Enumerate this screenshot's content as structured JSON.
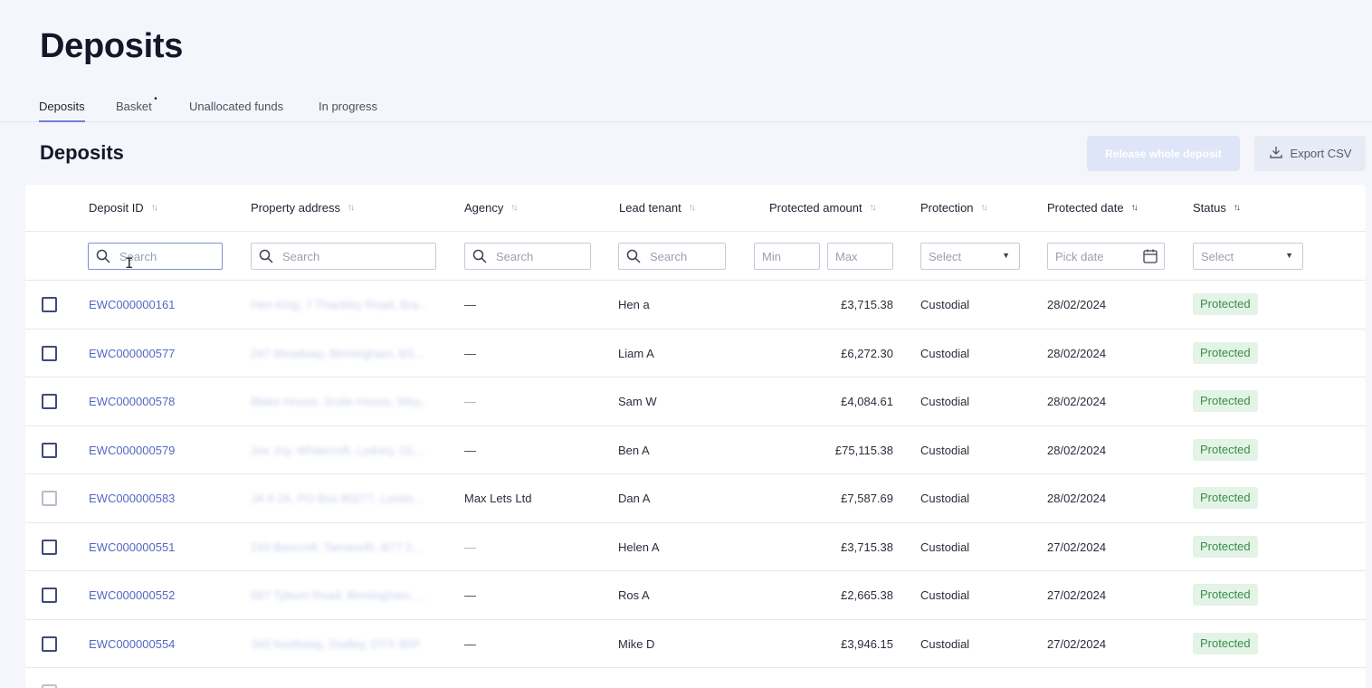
{
  "page": {
    "title": "Deposits"
  },
  "tabs": [
    {
      "label": "Deposits",
      "active": true
    },
    {
      "label": "Basket",
      "has_indicator": true
    },
    {
      "label": "Unallocated funds"
    },
    {
      "label": "In progress"
    }
  ],
  "section": {
    "title": "Deposits"
  },
  "actions": {
    "release_label": "Release whole deposit",
    "export_label": "Export CSV"
  },
  "columns": [
    {
      "label": "Deposit ID"
    },
    {
      "label": "Property address"
    },
    {
      "label": "Agency"
    },
    {
      "label": "Lead tenant"
    },
    {
      "label": "Protected amount"
    },
    {
      "label": "Protection"
    },
    {
      "label": "Protected date",
      "sort": "ascending"
    },
    {
      "label": "Status"
    }
  ],
  "filters": {
    "deposit_id_placeholder": "Search",
    "address_placeholder": "Search",
    "agency_placeholder": "Search",
    "tenant_placeholder": "Search",
    "amount_min_placeholder": "Min",
    "amount_max_placeholder": "Max",
    "protection_placeholder": "Select",
    "date_placeholder": "Pick date",
    "status_placeholder": "Select"
  },
  "rows": [
    {
      "id": "EWC000000161",
      "address": "Hen King, 7 Thackley Road, Bra...",
      "agency": "—",
      "tenant": "Hen a",
      "amount": "£3,715.38",
      "protection": "Custodial",
      "date": "28/02/2024",
      "status": "Protected"
    },
    {
      "id": "EWC000000577",
      "address": "247 Meadway, Birmingham, B3...",
      "agency": "—",
      "tenant": "Liam A",
      "amount": "£6,272.30",
      "protection": "Custodial",
      "date": "28/02/2024",
      "status": "Protected"
    },
    {
      "id": "EWC000000578",
      "address": "Blake House, Scale House, Wey...",
      "agency": "—",
      "tenant": "Sam W",
      "amount": "£4,084.61",
      "protection": "Custodial",
      "date": "28/02/2024",
      "status": "Protected"
    },
    {
      "id": "EWC000000579",
      "address": "Joe Joy, Whitecroft, Lydney, GL...",
      "agency": "—",
      "tenant": "Ben A",
      "amount": "£75,115.38",
      "protection": "Custodial",
      "date": "28/02/2024",
      "status": "Protected"
    },
    {
      "id": "EWC000000583",
      "address": "JA 9 JA, PO Box 80277, Londo...",
      "agency": "Max Lets Ltd",
      "tenant": "Dan A",
      "amount": "£7,587.69",
      "protection": "Custodial",
      "date": "28/02/2024",
      "status": "Protected"
    },
    {
      "id": "EWC000000551",
      "address": "243 Bancroft, Tamworth, B77 2...",
      "agency": "—",
      "tenant": "Helen A",
      "amount": "£3,715.38",
      "protection": "Custodial",
      "date": "27/02/2024",
      "status": "Protected"
    },
    {
      "id": "EWC000000552",
      "address": "567 Tyburn Road, Birmingham, ...",
      "agency": "—",
      "tenant": "Ros A",
      "amount": "£2,665.38",
      "protection": "Custodial",
      "date": "27/02/2024",
      "status": "Protected"
    },
    {
      "id": "EWC000000554",
      "address": "343 Northway, Dudley, DY3 3RP",
      "agency": "—",
      "tenant": "Mike D",
      "amount": "£3,946.15",
      "protection": "Custodial",
      "date": "27/02/2024",
      "status": "Protected"
    }
  ]
}
